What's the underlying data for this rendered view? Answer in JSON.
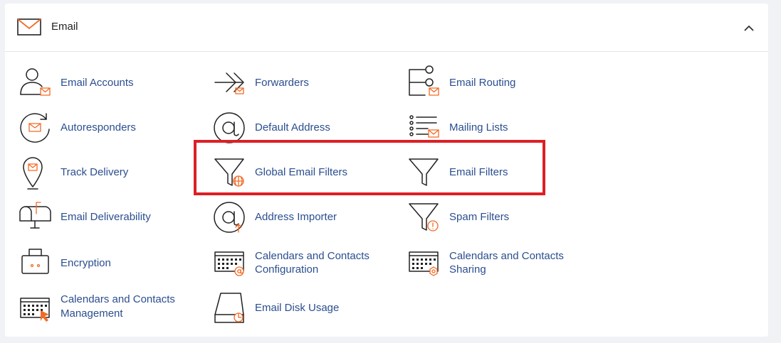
{
  "section": {
    "title": "Email",
    "header_icon": "envelope-icon",
    "collapse_icon": "chevron-up-icon"
  },
  "items": {
    "email_accounts": "Email Accounts",
    "forwarders": "Forwarders",
    "email_routing": "Email Routing",
    "autoresponders": "Autoresponders",
    "default_address": "Default Address",
    "mailing_lists": "Mailing Lists",
    "track_delivery": "Track Delivery",
    "global_email_filters": "Global Email Filters",
    "email_filters": "Email Filters",
    "email_deliverability": "Email Deliverability",
    "address_importer": "Address Importer",
    "spam_filters": "Spam Filters",
    "encryption": "Encryption",
    "calendars_contacts_configuration": [
      "Calendars and Contacts",
      "Configuration"
    ],
    "calendars_contacts_sharing": [
      "Calendars and Contacts",
      "Sharing"
    ],
    "calendars_contacts_management": [
      "Calendars and Contacts",
      "Management"
    ],
    "email_disk_usage": "Email Disk Usage"
  },
  "colors": {
    "link": "#2b4e8f",
    "accent": "#f26a25",
    "highlight_border": "#dd1f26"
  }
}
